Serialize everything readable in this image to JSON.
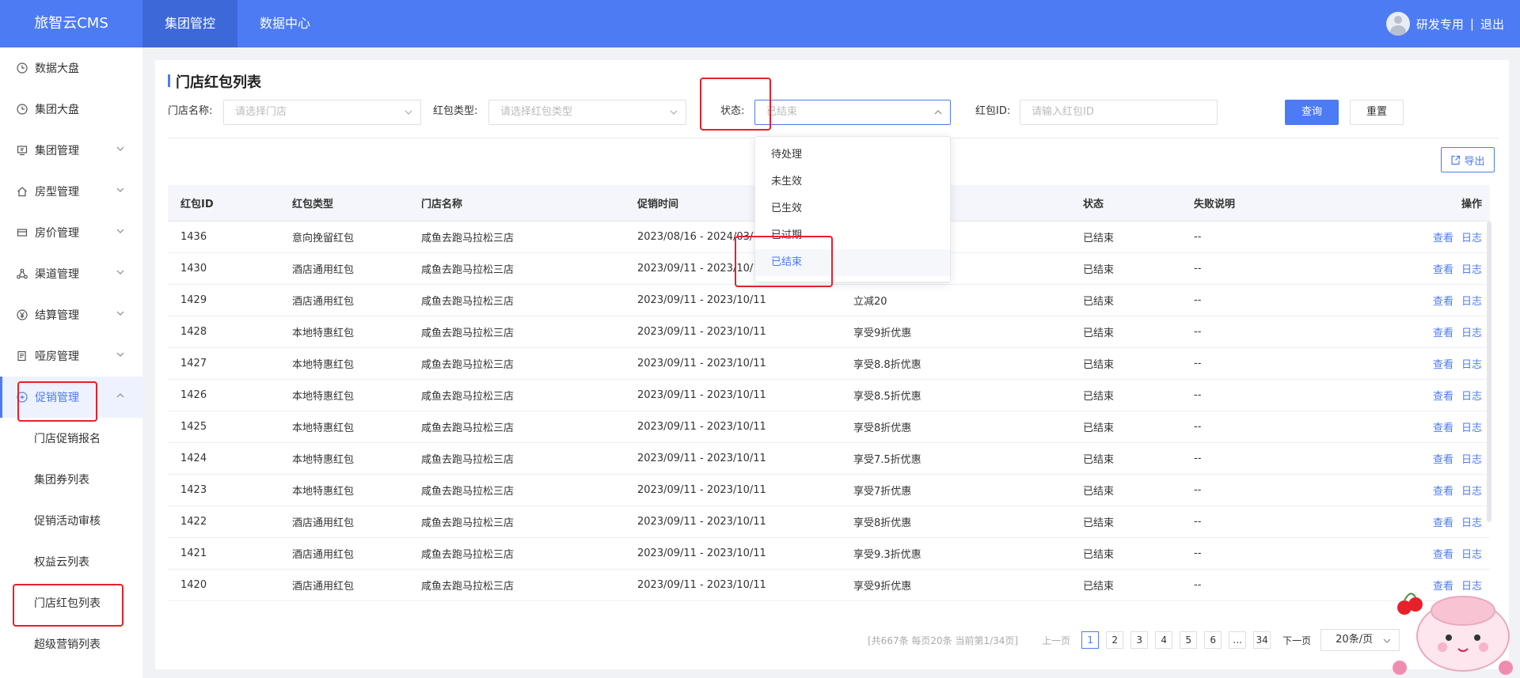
{
  "app": {
    "brand": "旅智云CMS"
  },
  "topnav": [
    {
      "label": "集团管控",
      "active": true
    },
    {
      "label": "数据中心",
      "active": false
    }
  ],
  "user": {
    "name": "研发专用",
    "separator": "|",
    "logout": "退出"
  },
  "sidebar": {
    "items": [
      {
        "label": "数据大盘",
        "icon": "clock-icon"
      },
      {
        "label": "集团大盘",
        "icon": "clock-icon"
      },
      {
        "label": "集团管理",
        "icon": "monitor-icon"
      },
      {
        "label": "房型管理",
        "icon": "home-icon"
      },
      {
        "label": "房价管理",
        "icon": "card-icon"
      },
      {
        "label": "渠道管理",
        "icon": "network-icon"
      },
      {
        "label": "结算管理",
        "icon": "yen-icon"
      },
      {
        "label": "哑房管理",
        "icon": "document-icon"
      },
      {
        "label": "促销管理",
        "icon": "gift-icon"
      }
    ],
    "submenu": [
      "门店促销报名",
      "集团券列表",
      "促销活动审核",
      "权益云列表",
      "门店红包列表",
      "超级营销列表"
    ]
  },
  "page": {
    "title": "门店红包列表"
  },
  "filters": {
    "store_label": "门店名称:",
    "store_placeholder": "请选择门店",
    "type_label": "红包类型:",
    "type_placeholder": "请选择红包类型",
    "status_label": "状态:",
    "status_value": "已结束",
    "id_label": "红包ID:",
    "id_placeholder": "请输入红包ID",
    "query_button": "查询",
    "reset_button": "重置",
    "export_button": "导出"
  },
  "status_options": [
    "待处理",
    "未生效",
    "已生效",
    "已过期",
    "已结束"
  ],
  "table": {
    "headers": [
      "红包ID",
      "红包类型",
      "门店名称",
      "促销时间",
      "",
      "状态",
      "失败说明",
      "操作"
    ],
    "view_label": "查看",
    "log_label": "日志",
    "rows": [
      [
        "1436",
        "意向挽留红包",
        "咸鱼去跑马拉松三店",
        "2023/08/16 - 2024/03/15",
        "",
        "已结束",
        "--"
      ],
      [
        "1430",
        "酒店通用红包",
        "咸鱼去跑马拉松三店",
        "2023/09/11 - 2023/10/11",
        "",
        "已结束",
        "--"
      ],
      [
        "1429",
        "酒店通用红包",
        "咸鱼去跑马拉松三店",
        "2023/09/11 - 2023/10/11",
        "立减20",
        "已结束",
        "--"
      ],
      [
        "1428",
        "本地特惠红包",
        "咸鱼去跑马拉松三店",
        "2023/09/11 - 2023/10/11",
        "享受9折优惠",
        "已结束",
        "--"
      ],
      [
        "1427",
        "本地特惠红包",
        "咸鱼去跑马拉松三店",
        "2023/09/11 - 2023/10/11",
        "享受8.8折优惠",
        "已结束",
        "--"
      ],
      [
        "1426",
        "本地特惠红包",
        "咸鱼去跑马拉松三店",
        "2023/09/11 - 2023/10/11",
        "享受8.5折优惠",
        "已结束",
        "--"
      ],
      [
        "1425",
        "本地特惠红包",
        "咸鱼去跑马拉松三店",
        "2023/09/11 - 2023/10/11",
        "享受8折优惠",
        "已结束",
        "--"
      ],
      [
        "1424",
        "本地特惠红包",
        "咸鱼去跑马拉松三店",
        "2023/09/11 - 2023/10/11",
        "享受7.5折优惠",
        "已结束",
        "--"
      ],
      [
        "1423",
        "本地特惠红包",
        "咸鱼去跑马拉松三店",
        "2023/09/11 - 2023/10/11",
        "享受7折优惠",
        "已结束",
        "--"
      ],
      [
        "1422",
        "酒店通用红包",
        "咸鱼去跑马拉松三店",
        "2023/09/11 - 2023/10/11",
        "享受8折优惠",
        "已结束",
        "--"
      ],
      [
        "1421",
        "酒店通用红包",
        "咸鱼去跑马拉松三店",
        "2023/09/11 - 2023/10/11",
        "享受9.3折优惠",
        "已结束",
        "--"
      ],
      [
        "1420",
        "酒店通用红包",
        "咸鱼去跑马拉松三店",
        "2023/09/11 - 2023/10/11",
        "享受9折优惠",
        "已结束",
        "--"
      ]
    ]
  },
  "pagination": {
    "summary": "[共667条 每页20条 当前第1/34页]",
    "prev": "上一页",
    "pages": [
      "1",
      "2",
      "3",
      "4",
      "5",
      "6"
    ],
    "ellipsis": "...",
    "last": "34",
    "next": "下一页",
    "page_size": "20条/页",
    "current": 1
  },
  "colors": {
    "primary": "#4c7bf3",
    "annotation": "#e8202a"
  }
}
